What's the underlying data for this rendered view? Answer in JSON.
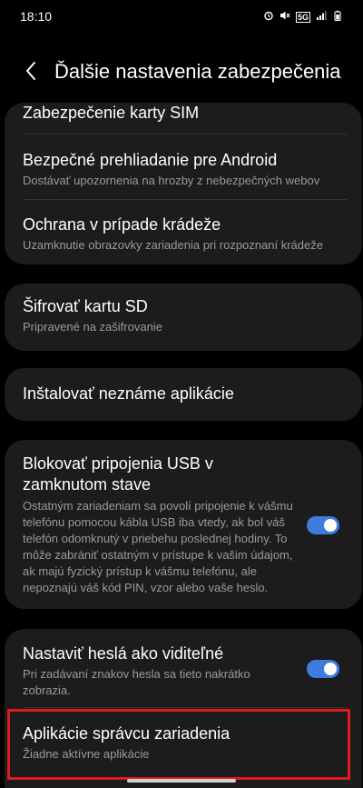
{
  "status_bar": {
    "time": "18:10",
    "icons": [
      "alarm-icon",
      "mute-icon",
      "5g-icon",
      "signal-icon",
      "battery-icon"
    ],
    "network": "5G"
  },
  "header": {
    "back_icon": "chevron-left-icon",
    "title": "Ďalšie nastavenia zabezpečenia"
  },
  "items": {
    "sim": {
      "title": "Zabezpečenie karty SIM"
    },
    "safe_browsing": {
      "title": "Bezpečné prehliadanie pre Android",
      "subtitle": "Dostávať upozornenia na hrozby z nebezpečných webov"
    },
    "theft": {
      "title": "Ochrana v prípade krádeže",
      "subtitle": "Uzamknutie obrazovky zariadenia pri rozpoznaní krádeže"
    },
    "sd": {
      "title": "Šifrovať kartu SD",
      "subtitle": "Pripravené na zašifrovanie"
    },
    "unknown_apps": {
      "title": "Inštalovať neznáme aplikácie"
    },
    "usb": {
      "title": "Blokovať pripojenia USB v zamknutom stave",
      "subtitle": "Ostatným zariadeniam sa povolí pripojenie k vášmu telefónu pomocou kábla USB iba vtedy, ak bol váš telefón odomknutý v priebehu poslednej hodiny. To môže zabrániť ostatným v prístupe k vašim údajom, ak majú fyzický prístup k vášmu telefónu, ale nepoznajú váš kód PIN, vzor alebo vaše heslo.",
      "toggle_on": true
    },
    "passwords": {
      "title": "Nastaviť heslá ako viditeľné",
      "subtitle": "Pri zadávaní znakov hesla sa tieto nakrátko zobrazia.",
      "toggle_on": true
    },
    "device_admin": {
      "title": "Aplikácie správcu zariadenia",
      "subtitle": "Žiadne aktívne aplikácie"
    }
  },
  "colors": {
    "background": "#000000",
    "card": "#1c1c1e",
    "accent": "#3e7de0",
    "highlight": "#e01b1b"
  }
}
